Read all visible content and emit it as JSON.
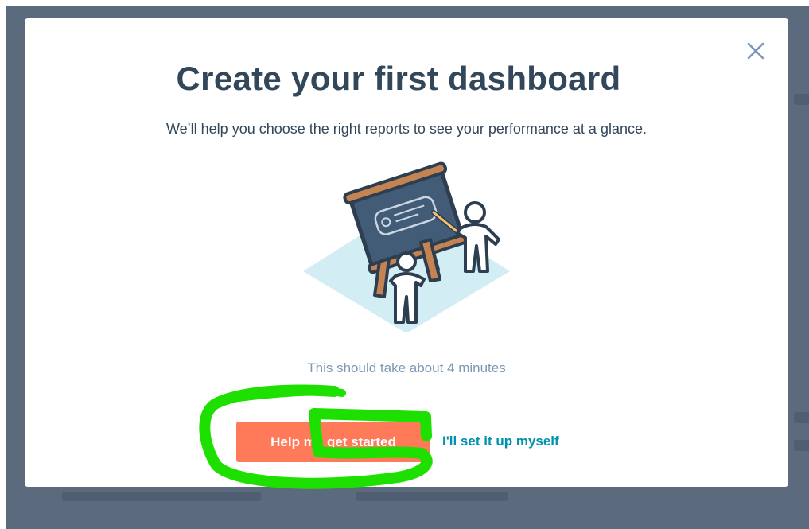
{
  "modal": {
    "title": "Create your first dashboard",
    "subtitle": "We’ll help you choose the right reports to see your performance at a glance.",
    "duration_note": "This should take about 4 minutes",
    "primary_button_label": "Help me get started",
    "secondary_link_label": "I'll set it up myself",
    "close_icon": "close-icon"
  },
  "colors": {
    "title": "#33475b",
    "primary_button": "#ff7a59",
    "link": "#0091ae",
    "muted_text": "#7c98b6",
    "annotation_highlight": "#1ee000",
    "backdrop": "#5b6b7d"
  }
}
